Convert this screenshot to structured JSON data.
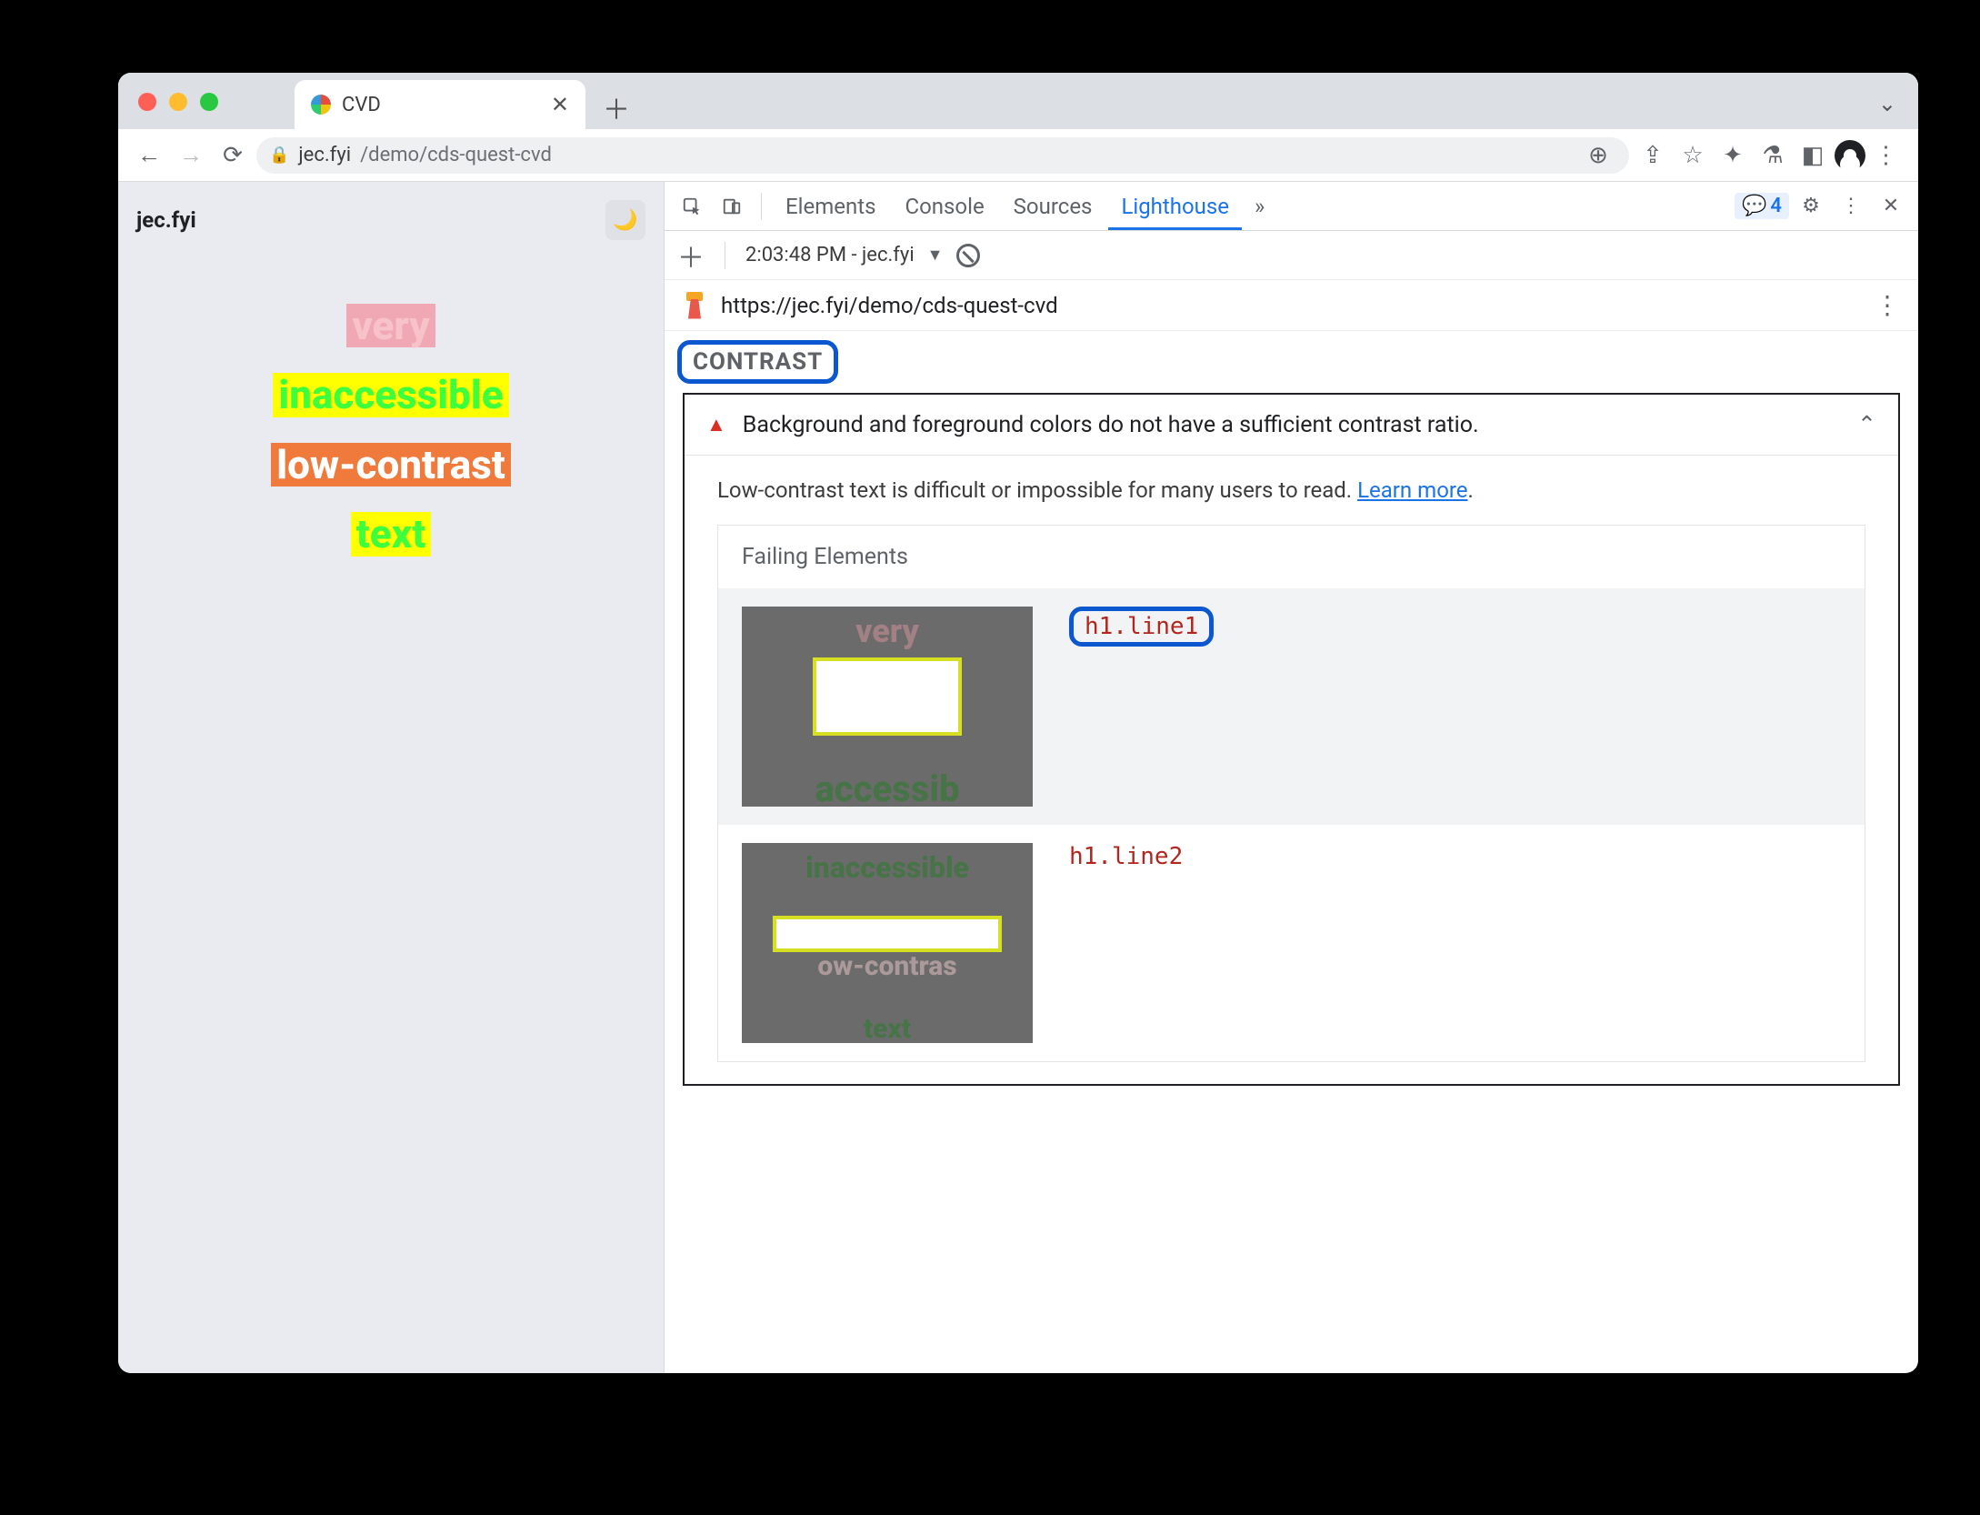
{
  "tab": {
    "title": "CVD"
  },
  "omnibox": {
    "host": "jec.fyi",
    "path": "/demo/cds-quest-cvd"
  },
  "page": {
    "site": "jec.fyi",
    "words": [
      "very",
      "inaccessible",
      "low-contrast",
      "text"
    ]
  },
  "devtools": {
    "tabs": [
      "Elements",
      "Console",
      "Sources",
      "Lighthouse"
    ],
    "active_tab": "Lighthouse",
    "badge_count": "4",
    "toolbar_time": "2:03:48 PM - jec.fyi",
    "url": "https://jec.fyi/demo/cds-quest-cvd",
    "section": "CONTRAST",
    "audit_title": "Background and foreground colors do not have a sufficient contrast ratio.",
    "audit_desc_pre": "Low-contrast text is difficult or impossible for many users to read. ",
    "audit_learn": "Learn more",
    "audit_desc_post": ".",
    "failing_title": "Failing Elements",
    "failing": [
      {
        "selector": "h1.line1"
      },
      {
        "selector": "h1.line2"
      }
    ]
  }
}
